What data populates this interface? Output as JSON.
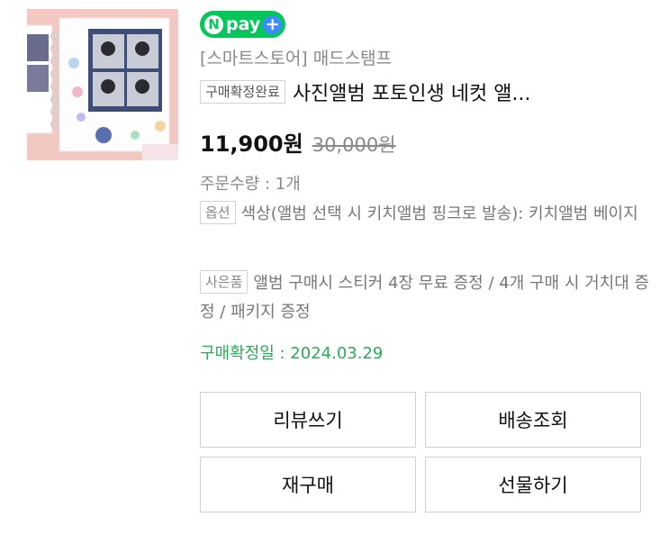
{
  "npay": {
    "n": "N",
    "label": "pay",
    "plus": "+"
  },
  "product": {
    "store": "[스마트스토어] 매드스탬프",
    "status_badge": "구매확정완료",
    "title": "사진앨범 포토인생 네컷 앨...",
    "price": "11,900원",
    "original_price": "30,000원",
    "quantity": "주문수량 : 1개",
    "option_badge": "옵션",
    "option_text": "색상(앨범 선택 시 키치앨범 핑크로 발송): 키치앨범 베이지",
    "gift_badge": "사은품",
    "gift_text": "앨범 구매시 스티커 4장 무료 증정 / 4개 구매 시 거치대 증정 / 패키지 증정",
    "confirm_date": "구매확정일 : 2024.03.29"
  },
  "buttons": {
    "review": "리뷰쓰기",
    "tracking": "배송조회",
    "rebuy": "재구매",
    "gift": "선물하기"
  },
  "colors": {
    "npay_green": "#03c75a",
    "confirm_green": "#2fa85a"
  }
}
